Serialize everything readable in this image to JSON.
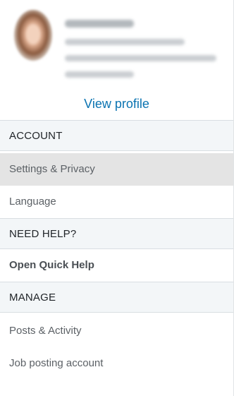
{
  "profile": {
    "view_profile_label": "View profile"
  },
  "sections": [
    {
      "header": "ACCOUNT",
      "items": [
        {
          "label": "Settings & Privacy",
          "active": true
        },
        {
          "label": "Language",
          "active": false
        }
      ]
    },
    {
      "header": "NEED HELP?",
      "items": [
        {
          "label": "Open Quick Help",
          "bold": true
        }
      ]
    },
    {
      "header": "MANAGE",
      "items": [
        {
          "label": "Posts & Activity"
        },
        {
          "label": "Job posting account"
        }
      ]
    }
  ],
  "colors": {
    "link": "#0a73b1",
    "section_bg": "#f3f6f8",
    "active_bg": "#e4e4e4"
  }
}
